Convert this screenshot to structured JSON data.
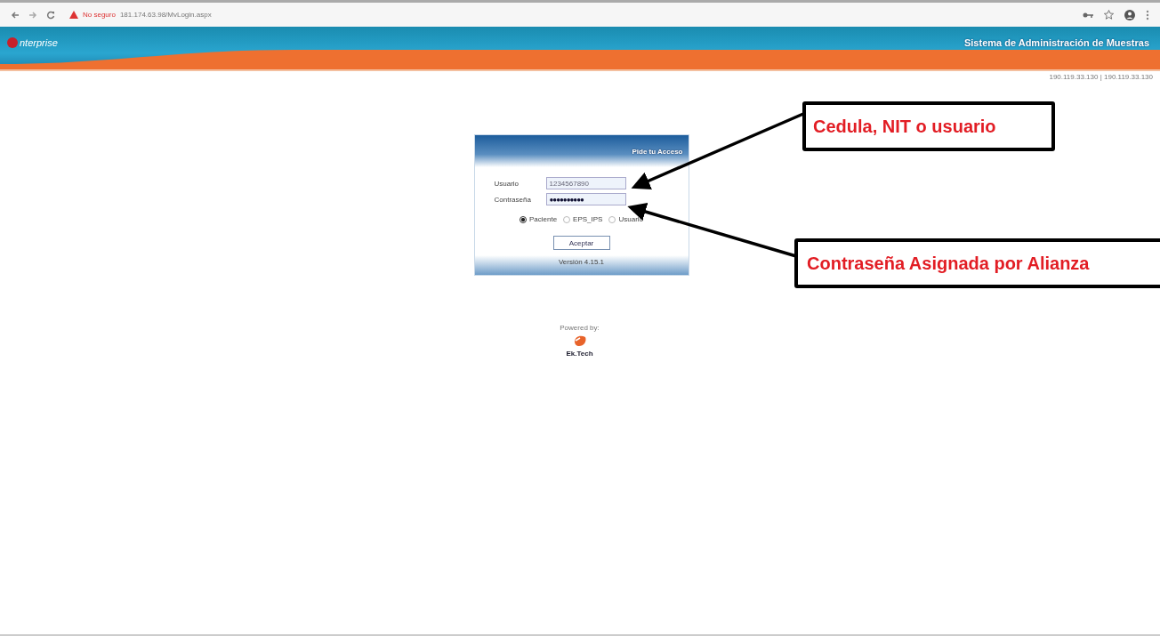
{
  "browser": {
    "security": "No seguro",
    "url": "181.174.63.98/MvLogin.aspx"
  },
  "header": {
    "logo": "nterprise",
    "title": "Sistema de Administración de Muestras"
  },
  "server_info": "190.119.33.130 | 190.119.33.130",
  "login": {
    "title": "Pide tu Acceso",
    "fields": [
      {
        "label": "Usuario",
        "value": "1234567890",
        "kind": "text"
      },
      {
        "label": "Contraseña",
        "value": "●●●●●●●●●●",
        "kind": "password"
      }
    ],
    "user_types": [
      {
        "label": "Paciente",
        "selected": true
      },
      {
        "label": "EPS_IPS",
        "selected": false
      },
      {
        "label": "Usuario",
        "selected": false
      }
    ],
    "button": "Aceptar",
    "version": "Versión 4.15.1"
  },
  "powered": {
    "label": "Powered by:",
    "brand": "Ek.Tech"
  },
  "callouts": [
    {
      "text": "Cedula, NIT o usuario"
    },
    {
      "text": "Contraseña Asignada por Alianza"
    }
  ]
}
